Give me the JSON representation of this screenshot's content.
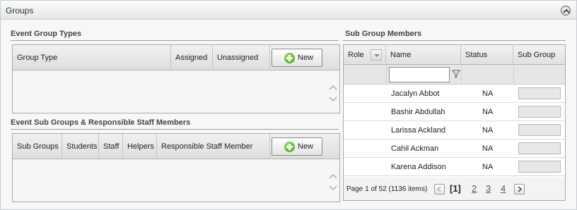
{
  "panel": {
    "title": "Groups",
    "collapse_icon": "chevron-up-circle-icon"
  },
  "event_group_types": {
    "title": "Event Group Types",
    "columns": [
      "Group Type",
      "Assigned",
      "Unassigned"
    ],
    "new_label": "New"
  },
  "event_sub_groups": {
    "title": "Event Sub Groups & Responsible Staff Members",
    "columns": [
      "Sub Groups",
      "Students",
      "Staff",
      "Helpers",
      "Responsible Staff Member"
    ],
    "new_label": "New"
  },
  "sub_group_members": {
    "title": "Sub Group Members",
    "columns": [
      "Role",
      "Name",
      "Status",
      "Sub Group"
    ],
    "filter_placeholder": "",
    "rows": [
      {
        "name": "Jacalyn Abbot",
        "status": "NA"
      },
      {
        "name": "Bashir Abdullah",
        "status": "NA"
      },
      {
        "name": "Larissa Ackland",
        "status": "NA"
      },
      {
        "name": "Cahil Ackman",
        "status": "NA"
      },
      {
        "name": "Karena Addison",
        "status": "NA"
      }
    ],
    "pager": {
      "info": "Page 1 of 52 (1136 items)",
      "current": "[1]",
      "pages": [
        "2",
        "3",
        "4"
      ]
    }
  },
  "colors": {
    "accent_green": "#3f9c1a",
    "header_bg": "#e4e7ea"
  }
}
